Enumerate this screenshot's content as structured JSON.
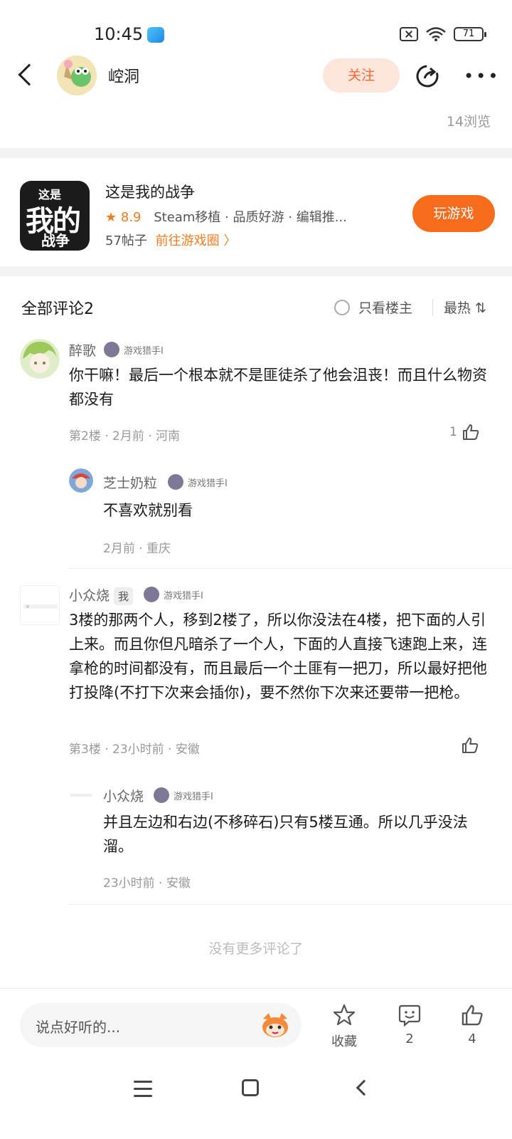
{
  "status_bar": {
    "time": "10:45",
    "battery": "71"
  },
  "header": {
    "title": "崆洞",
    "follow_label": "关注"
  },
  "views": "14浏览",
  "game": {
    "icon_text": [
      "这是",
      "我的",
      "战争"
    ],
    "name": "这是我的战争",
    "rating": "8.9",
    "tags": "Steam移植 · 品质好游 · 编辑推...",
    "posts": "57帖子",
    "circle_link": "前往游戏圈 〉",
    "play_label": "玩游戏"
  },
  "comments_header": {
    "title": "全部评论2",
    "only_host": "只看楼主",
    "sort": "最热 ⇅"
  },
  "comments": [
    {
      "name": "醉歌",
      "level": "游戏猎手I",
      "text": "你干嘛！最后一个根本就不是匪徒杀了他会沮丧！而且什么物资都没有",
      "meta": "第2楼 · 2月前 · 河南",
      "likes": "1",
      "reply": {
        "name": "芝士奶粒",
        "level": "游戏猎手I",
        "text": "不喜欢就别看",
        "meta": "2月前 · 重庆"
      }
    },
    {
      "name": "小众烧",
      "me_badge": "我",
      "level": "游戏猎手I",
      "text": "3楼的那两个人，移到2楼了，所以你没法在4楼，把下面的人引上来。而且你但凡暗杀了一个人，下面的人直接飞速跑上来，连拿枪的时间都没有，而且最后一个土匪有一把刀，所以最好把他打投降(不打下次来会插你)，要不然你下次来还要带一把枪。",
      "meta": "第3楼 · 23小时前 · 安徽",
      "likes": "",
      "reply": {
        "name": "小众烧",
        "level": "游戏猎手I",
        "text": "并且左边和右边(不移碎石)只有5楼互通。所以几乎没法溜。",
        "meta": "23小时前 · 安徽"
      }
    }
  ],
  "no_more": "没有更多评论了",
  "bottom_bar": {
    "placeholder": "说点好听的...",
    "favorite_label": "收藏",
    "comment_count": "2",
    "like_count": "4"
  },
  "colors": {
    "accent": "#f76c1c",
    "follow_bg": "#fde5dc"
  }
}
